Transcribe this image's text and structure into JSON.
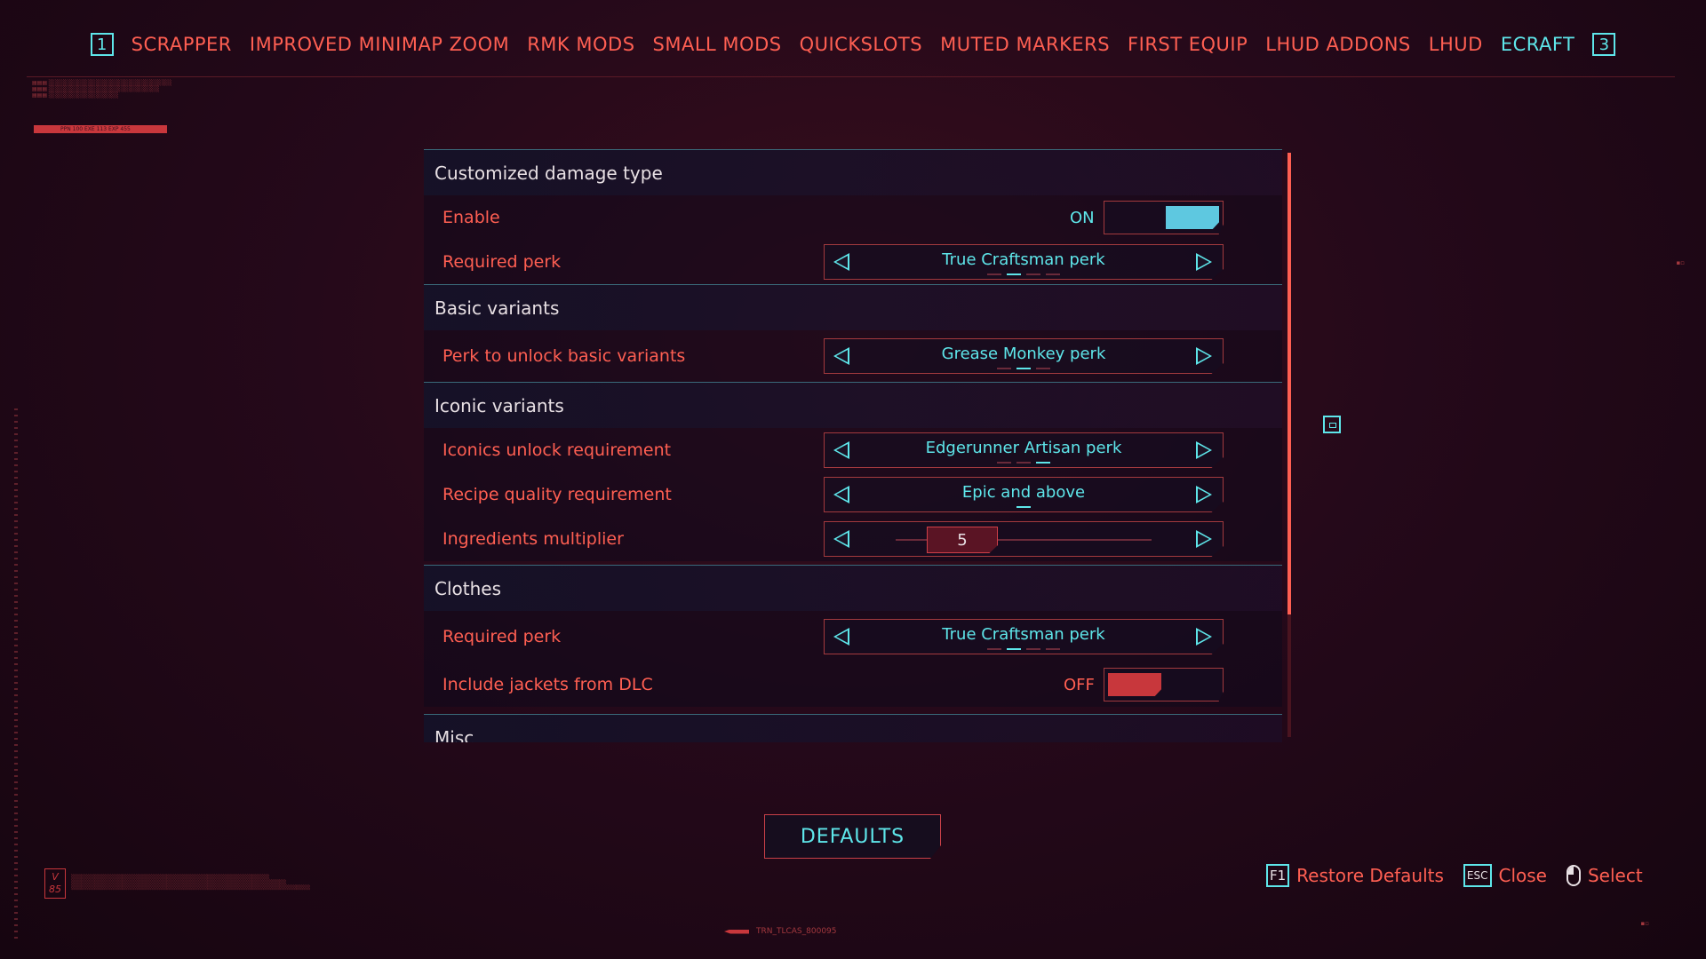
{
  "tabs": {
    "left_key": "1",
    "right_key": "3",
    "items": [
      "SCRAPPER",
      "IMPROVED MINIMAP ZOOM",
      "RMK MODS",
      "SMALL MODS",
      "QUICKSLOTS",
      "MUTED MARKERS",
      "FIRST EQUIP",
      "LHUD ADDONS",
      "LHUD",
      "ECRAFT"
    ],
    "active": "ECRAFT"
  },
  "sections": {
    "damage": {
      "title": "Customized damage type",
      "enable": {
        "label": "Enable",
        "state": "ON",
        "on": true
      },
      "required_perk": {
        "label": "Required perk",
        "value": "True Craftsman perk"
      }
    },
    "basic": {
      "title": "Basic variants",
      "perk_unlock": {
        "label": "Perk to unlock basic variants",
        "value": "Grease Monkey perk"
      }
    },
    "iconic": {
      "title": "Iconic variants",
      "unlock_req": {
        "label": "Iconics unlock requirement",
        "value": "Edgerunner Artisan perk"
      },
      "recipe_quality": {
        "label": "Recipe quality requirement",
        "value": "Epic and above"
      },
      "ingredients": {
        "label": "Ingredients multiplier",
        "value": "5"
      }
    },
    "clothes": {
      "title": "Clothes",
      "required_perk": {
        "label": "Required perk",
        "value": "True Craftsman perk"
      },
      "jackets": {
        "label": "Include jackets from DLC",
        "state": "OFF",
        "on": false
      }
    },
    "misc": {
      "title": "Misc"
    }
  },
  "defaults_button": "DEFAULTS",
  "hints": {
    "restore": {
      "key": "F1",
      "label": "Restore Defaults"
    },
    "close": {
      "key": "ESC",
      "label": "Close"
    },
    "select": {
      "label": "Select"
    }
  },
  "deco": {
    "version": "V 85",
    "bottom_code": "TRN_TLCAS_800095",
    "bar_code": "PPN 100 EXE 113 EXP 455"
  },
  "colors": {
    "accent_cyan": "#5ee6ea",
    "accent_red": "#ff5f52",
    "toggle_on": "#5ec8e0",
    "toggle_off": "#c8373c"
  }
}
